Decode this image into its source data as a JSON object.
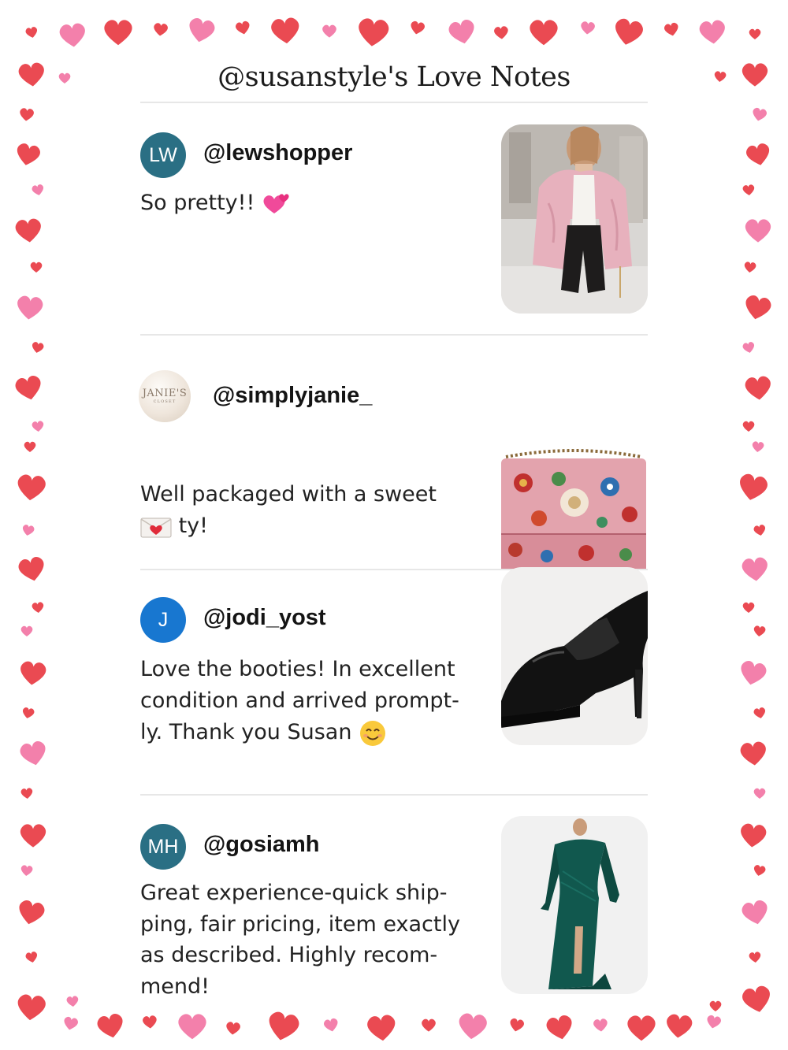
{
  "page": {
    "title": "@susanstyle's Love Notes"
  },
  "reviews": [
    {
      "avatar_initials": "LW",
      "username": "@lewshopper",
      "comment": "So pretty!!",
      "comment_emoji": "two-hearts-icon",
      "item_image": "pink-faux-fur-jacket-image"
    },
    {
      "avatar_text": "JANIE'S",
      "avatar_subtext": "CLOSET",
      "username": "@simplyjanie_",
      "comment_line1": "Well packaged with a sweet",
      "comment_line2": "ty!",
      "comment_emoji": "love-letter-icon",
      "item_image": "floral-beaded-clutch-image"
    },
    {
      "avatar_initials": "J",
      "username": "@jodi_yost",
      "comment_lines": [
        "Love the booties! In excellent",
        "condition and arrived prompt-",
        "ly. Thank you Susan"
      ],
      "comment_emoji": "smiling-face-icon",
      "item_image": "black-platform-bootie-image"
    },
    {
      "avatar_initials": "MH",
      "username": "@gosiamh",
      "comment_lines": [
        "Great experience-quick ship-",
        "ping, fair pricing, item exactly",
        "as described. Highly recom-",
        "mend!"
      ],
      "item_image": "green-off-shoulder-gown-image"
    }
  ],
  "colors": {
    "heart_red": "#e8363f",
    "heart_pink": "#f272a2",
    "avatar_teal": "#2a6f84",
    "avatar_blue": "#1877d0"
  }
}
